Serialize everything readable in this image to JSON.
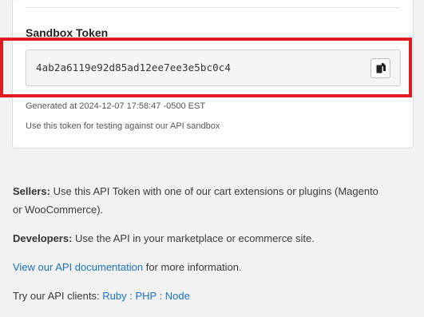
{
  "sandbox": {
    "title": "Sandbox Token",
    "token": "4ab2a6119e92d85ad12ee7ee3e5bc0c4",
    "generated": "Generated at 2024-12-07 17:58:47 -0500 EST",
    "note": "Use this token for testing against our API sandbox",
    "copy_icon": "copy-icon"
  },
  "info": {
    "sellers_label": "Sellers:",
    "sellers_text_line1": " Use this API Token with one of our cart extensions or plugins (Magento",
    "sellers_text_line2": "or WooCommerce).",
    "developers_label": "Developers:",
    "developers_text": " Use the API in your marketplace or ecommerce site.",
    "docs_link": "View our API documentation",
    "docs_suffix": " for more information.",
    "clients_prefix": "Try our API clients: ",
    "client_ruby": "Ruby",
    "sep1": " : ",
    "client_php": "PHP",
    "sep2": " : ",
    "client_node": "Node"
  },
  "colors": {
    "highlight": "#e01b24",
    "link": "#1a73c4"
  }
}
